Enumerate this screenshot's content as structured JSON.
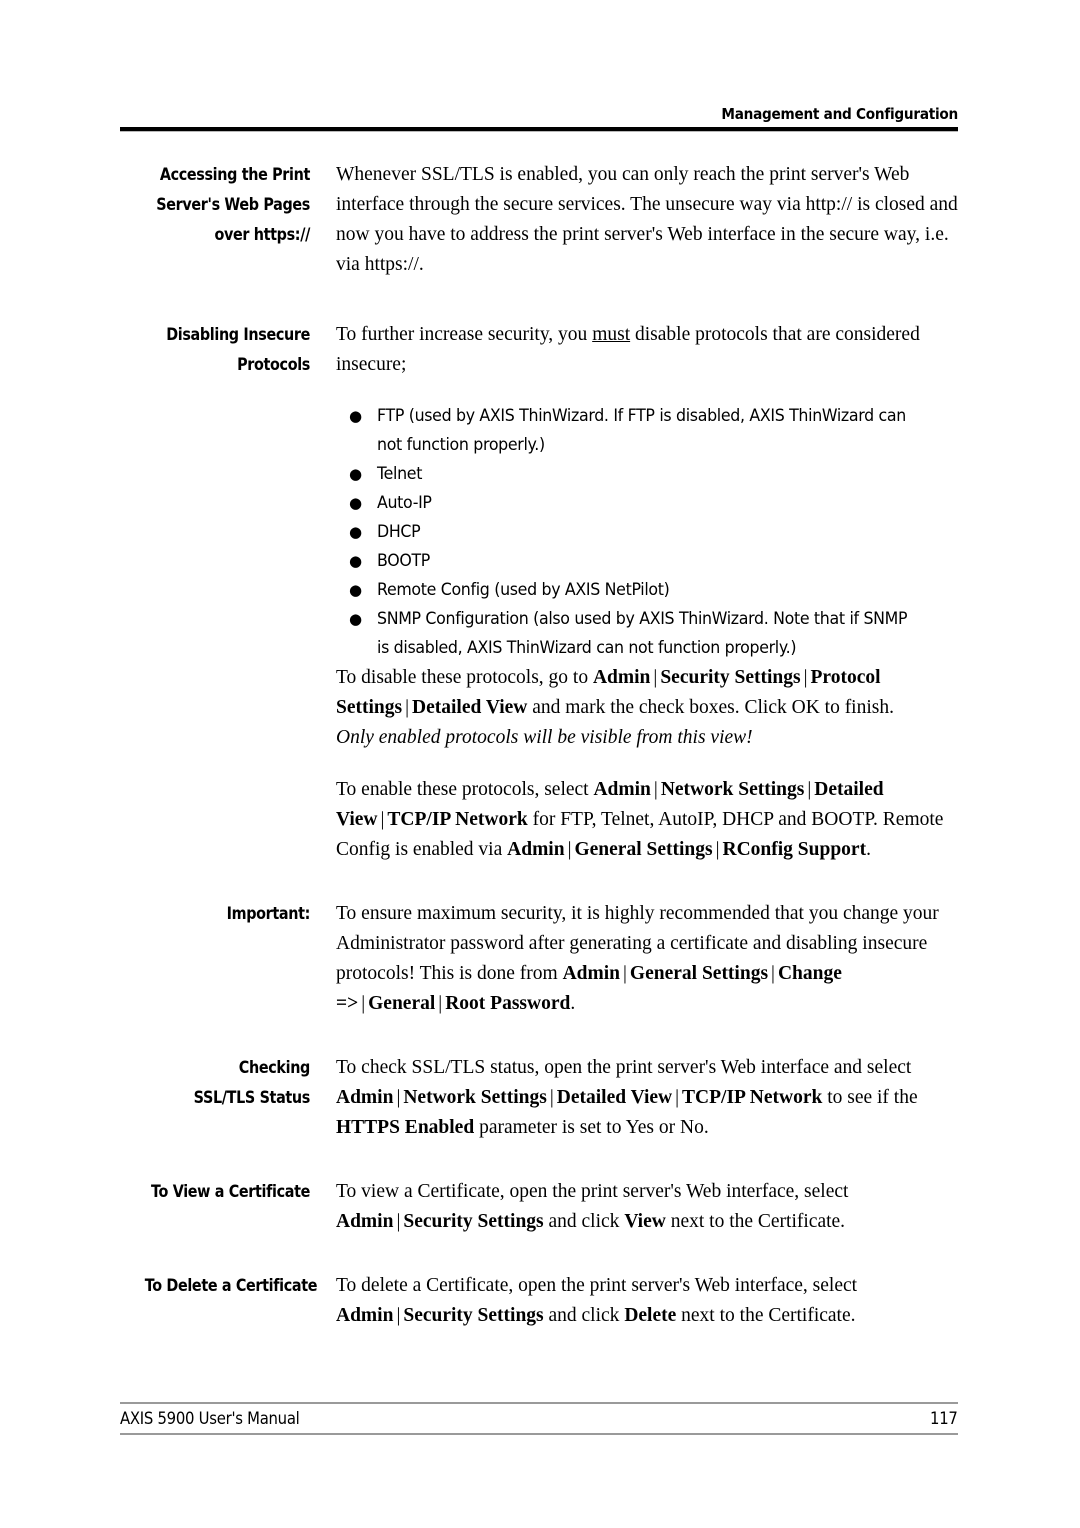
{
  "header": {
    "running_title": "Management and Configuration"
  },
  "sections": [
    {
      "label_lines": [
        "Accessing the Print",
        "Server's Web Pages",
        "over https://"
      ],
      "paragraph": "Whenever SSL/TLS is enabled, you can only reach the print server's Web interface through the secure services. The unsecure way via http:// is closed and now you have to address the print server's Web interface in the secure way, i.e. via https://."
    },
    {
      "label_lines": [
        "Disabling Insecure",
        "Protocols"
      ],
      "intro_a": "To further increase security, you ",
      "intro_must": "must",
      "intro_b": " disable protocols that are considered insecure;",
      "bullets": [
        "FTP (used by AXIS ThinWizard. If FTP is disabled, AXIS ThinWizard can not function properly.)",
        "Telnet",
        "Auto-IP",
        "DHCP",
        "BOOTP",
        "Remote Config (used by AXIS NetPilot)",
        "SNMP Configuration (also used by AXIS ThinWizard. Note that if SNMP is disabled, AXIS ThinWizard can not function properly.)"
      ],
      "disable_p1": {
        "t1": "To disable these protocols, go to ",
        "b1": "Admin",
        "bar1": "|",
        "b2": "Security Settings",
        "bar2": "|",
        "b3": "Protocol Settings",
        "bar3": "|",
        "b4": "Detailed View",
        "t2": " and mark the check boxes. Click OK to finish.",
        "italic": "Only enabled protocols will be visible from this view!"
      },
      "enable_p2": {
        "t1": "To enable these protocols, select ",
        "b1": "Admin",
        "bar1": "|",
        "b2": "Network Settings",
        "bar2": "|",
        "b3": "Detailed View",
        "bar3": "|",
        "b4": "TCP/IP Network",
        "t2": " for FTP, Telnet, AutoIP, DHCP and BOOTP. Remote Config is enabled via ",
        "b5": "Admin",
        "bar4": "|",
        "b6": "General Settings",
        "bar5": "|",
        "b7": "RConfig Support",
        "t3": "."
      }
    },
    {
      "label_lines": [
        "Important:"
      ],
      "p": {
        "t1": "To ensure maximum security, it is highly recommended that you change your Administrator password after generating a certificate and disabling insecure protocols! This is done from ",
        "b1": "Admin",
        "bar1": "|",
        "b2": "General Settings",
        "bar2": "|",
        "b3": "Change =>",
        "bar3": "|",
        "b4": "General",
        "bar4": "|",
        "b5": "Root Password",
        "t2": "."
      }
    },
    {
      "label_lines": [
        "Checking",
        "SSL/TLS Status"
      ],
      "p": {
        "t1": "To check SSL/TLS status, open the print server's Web interface and select ",
        "b1": "Admin",
        "bar1": "|",
        "b2": "Network Settings",
        "bar2": "|",
        "b3": "Detailed View",
        "bar3": "|",
        "b4": "TCP/IP Network",
        "t2": " to see if the ",
        "b5": "HTTPS Enabled",
        "t3": " parameter is set to Yes or No."
      }
    },
    {
      "label_lines": [
        "To View a Certificate"
      ],
      "p": {
        "t1": "To view a Certificate, open the print server's Web interface, select ",
        "b1": "Admin",
        "bar1": "|",
        "b2": "Security Settings",
        "t2": " and click ",
        "b3": "View",
        "t3": " next to the Certificate."
      }
    },
    {
      "label_lines": [
        "To Delete a Certificate"
      ],
      "p": {
        "t1": "To delete a Certificate, open the print server's Web interface, select ",
        "b1": "Admin",
        "bar1": "|",
        "b2": "Security Settings",
        "t2": " and click ",
        "b3": "Delete",
        "t3": " next to the Certificate."
      }
    }
  ],
  "footer": {
    "left": "AXIS 5900 User's Manual",
    "page_number": "117"
  }
}
